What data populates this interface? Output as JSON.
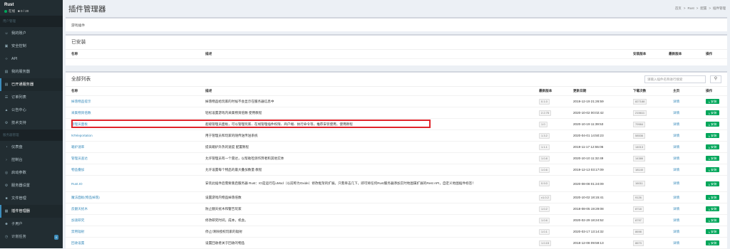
{
  "sidebar": {
    "app_name": "Rust",
    "online_label": "在线",
    "players": "0 / 20",
    "section_user": "用户管理",
    "items_top": [
      {
        "label": "我的账户",
        "icon": "user-icon"
      },
      {
        "label": "安全控制",
        "icon": "lock-icon"
      },
      {
        "label": "API",
        "icon": "code-icon"
      },
      {
        "label": "我的服务器",
        "icon": "server-icon"
      },
      {
        "label": "已开通服务器",
        "icon": "server-icon"
      },
      {
        "label": "订单列表",
        "icon": "list-icon"
      },
      {
        "label": "公告中心",
        "icon": "bell-icon"
      },
      {
        "label": "技术支持",
        "icon": "support-icon"
      }
    ],
    "section_server": "服务器管理",
    "items_bottom": [
      {
        "label": "仪表盘",
        "icon": "dashboard-icon"
      },
      {
        "label": "控制台",
        "icon": "terminal-icon"
      },
      {
        "label": "启动参数",
        "icon": "settings-icon"
      },
      {
        "label": "服务器设置",
        "icon": "gear-icon"
      },
      {
        "label": "文件管理",
        "icon": "folder-icon"
      },
      {
        "label": "插件管理器",
        "icon": "plugin-icon"
      },
      {
        "label": "子用户",
        "icon": "users-icon"
      },
      {
        "label": "计划任务",
        "icon": "clock-icon",
        "badge": "0"
      }
    ]
  },
  "header": {
    "title": "插件管理器",
    "breadcrumb": [
      "首页",
      "Rust",
      "配置",
      "插件管理"
    ]
  },
  "tab_label": "游戏插件",
  "installed": {
    "title": "已安装",
    "headers": {
      "name": "名称",
      "desc": "描述",
      "install_version": "安装版本",
      "latest_version": "最新版本",
      "action": "操作"
    }
  },
  "all": {
    "title": "全部列表",
    "search_placeholder": "请输入插件名称进行搜索",
    "headers": {
      "name": "名称",
      "desc": "描述",
      "latest_version": "最新版本",
      "updated": "更新日期",
      "downloads": "下载次数",
      "home": "主页",
      "action": "操作"
    },
    "install_label": "安装",
    "home_label": "详情",
    "rows": [
      {
        "name": "掉落物品提示",
        "desc": "掉落物品给玩家的时候不会显示在服务器信息中",
        "version": "0.1.0",
        "date": "2019-12-19 21:26:59",
        "dl": "827188"
      },
      {
        "name": "采集物资倍数",
        "desc": "轻松设置游戏内采集物资倍数 使用教程",
        "version": "2.2.75",
        "date": "2020-10-02 00:02:42",
        "dl": "215611"
      },
      {
        "name": "管理员面板",
        "desc": "超级管理员面板，可以管理玩家、在线管理插件权限、商户端、执行命令等，推荐安装使用。使用教程",
        "version": "1.0",
        "date": "2020-10-19 11:39:53",
        "dl": "79984"
      },
      {
        "name": "NTeleportation",
        "desc": "用于管理员和玩家的随传送传送系统",
        "version": "1.3.2",
        "date": "2020-04-01 14:50:23",
        "dl": "58536"
      },
      {
        "name": "箱炉速率",
        "desc": "提高箱炉升热的速度 配置教程",
        "version": "1.1.1",
        "date": "2019-11-17 12:55:06",
        "dl": "14013"
      },
      {
        "name": "管理员查达",
        "desc": "允许管理员有一个雷达，以帮助检测作弊者和其他实体",
        "version": "1.0.8",
        "date": "2020-10-10 11:32:49",
        "dl": "14386"
      },
      {
        "name": "物品叠加",
        "desc": "允许设置每个物品的最大叠加数量 教程",
        "version": "1.0.6",
        "date": "2019-12-13 03:17:09",
        "dl": "18140"
      },
      {
        "name": "Rust.IO",
        "desc": "安装此插件后需要重启服务器 Rust：IO是运行在uMod（以前称为Oxide）修改框架的扩展。只需单击几下，即可将任何Rust服务器添加实时地图属扩展的Rest API，自定义地图插件标签！",
        "version": "0.9.0",
        "date": "2020-08-08 01:24:09",
        "dl": "16011"
      },
      {
        "name": "魔法面板(物品掉落)",
        "desc": "设置游戏内物品掉落倍数",
        "version": "v1.0.2",
        "date": "2020-10-02 18:15:41",
        "dl": "9126"
      },
      {
        "name": "反翻天扰木",
        "desc": "防止翻天扰木和警告玩家",
        "version": "1.0.2",
        "date": "2018-08-05 19:29:08",
        "dl": "8718"
      },
      {
        "name": "加速研究",
        "desc": "修改研究时间，成本，机会。",
        "version": "1.0.6",
        "date": "2020-02-29 18:24:52",
        "dl": "8797"
      },
      {
        "name": "禁用辐射",
        "desc": "停止/清除授权玩家的辐射",
        "version": "1.0.1",
        "date": "2020-03-17 13:14:32",
        "dl": "8698"
      },
      {
        "name": "回收设置",
        "desc": "设置回收者关于回收的物品",
        "version": "1.0.15",
        "date": "2018-12-08 09:59:13",
        "dl": "8673"
      }
    ]
  },
  "colors": {
    "sidebar": "#222d32",
    "accent": "#3c8dbc",
    "install_button": "#00a65a",
    "highlight": "#e0242a"
  }
}
